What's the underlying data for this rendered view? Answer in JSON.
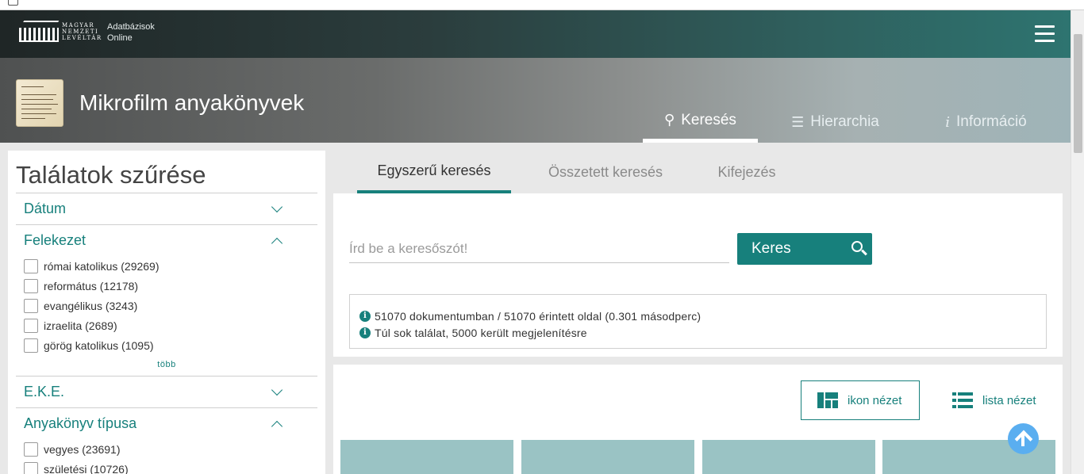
{
  "header": {
    "logo_text": [
      "MAGYAR",
      "NEMZETI",
      "LEVÉLTÁR"
    ],
    "subtitle": [
      "Adatbázisok",
      "Online"
    ],
    "menu_icon": "hamburger-menu-icon"
  },
  "hero": {
    "title": "Mikrofilm anyakönyvek",
    "tabs": [
      {
        "label": "Keresés",
        "icon": "search-icon",
        "active": true
      },
      {
        "label": "Hierarchia",
        "icon": "hierarchy-icon",
        "active": false
      },
      {
        "label": "Információ",
        "icon": "info-icon",
        "active": false
      }
    ]
  },
  "sidebar": {
    "title": "Találatok szűrése",
    "facets": [
      {
        "label": "Dátum",
        "expanded": false,
        "options": []
      },
      {
        "label": "Felekezet",
        "expanded": true,
        "options": [
          "római katolikus (29269)",
          "református (12178)",
          "evangélikus (3243)",
          "izraelita (2689)",
          "görög katolikus (1095)"
        ],
        "more_label": "több"
      },
      {
        "label": "E.K.E.",
        "expanded": false,
        "options": []
      },
      {
        "label": "Anyakönyv típusa",
        "expanded": true,
        "options": [
          "vegyes (23691)",
          "születési (10726)"
        ]
      }
    ]
  },
  "search": {
    "tabs": [
      "Egyszerű keresés",
      "Összetett keresés",
      "Kifejezés"
    ],
    "active_tab": 0,
    "placeholder": "Írd be a keresőszót!",
    "value": "",
    "button_label": "Keres",
    "info": [
      "51070 dokumentumban / 51070 érintett oldal (0.301 másodperc)",
      "Túl sok találat, 5000 került megjelenítésre"
    ]
  },
  "results": {
    "view_icon_label": "ikon nézet",
    "view_list_label": "lista nézet",
    "active_view": "icon"
  },
  "colors": {
    "accent": "#17807c",
    "scroll_top": "#5aaef0",
    "thumbnail": "#9ac3c4"
  }
}
